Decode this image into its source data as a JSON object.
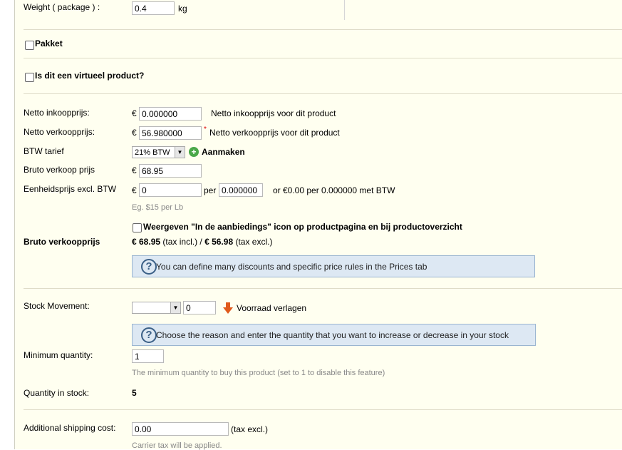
{
  "weight": {
    "label": "Weight ( package ) :",
    "value": "0.4",
    "unit": "kg"
  },
  "pakket": {
    "label": "Pakket"
  },
  "virtual": {
    "label": "Is dit een virtueel product?"
  },
  "netto_inkoop": {
    "label": "Netto inkoopprijs:",
    "currency": "€",
    "value": "0.000000",
    "note": "Netto inkoopprijs voor dit product"
  },
  "netto_verkoop": {
    "label": "Netto verkoopprijs:",
    "currency": "€",
    "value": "56.980000",
    "required": "*",
    "note": "Netto verkoopprijs voor dit product"
  },
  "btw": {
    "label": "BTW tarief",
    "selected": "21% BTW",
    "create_label": "Aanmaken"
  },
  "bruto_verkoop": {
    "label": "Bruto verkoop prijs",
    "currency": "€",
    "value": "68.95"
  },
  "unit_price": {
    "label": "Eenheidsprijs excl. BTW",
    "currency": "€",
    "value": "0",
    "per_label": "per",
    "per_value": "0.000000",
    "summary": "or €0.00 per 0.000000 met BTW",
    "hint": "Eg. $15 per Lb"
  },
  "on_sale": {
    "label": "Weergeven \"In de aanbiedings\" icon op productpagina en bij productoverzicht"
  },
  "bruto_summary": {
    "label": "Bruto verkoopprijs",
    "incl_value": "€ 68.95",
    "incl_text": "(tax incl.) /",
    "excl_value": "€ 56.98",
    "excl_text": "(tax excl.)"
  },
  "help_prices": "You can define many discounts and specific price rules in the Prices tab",
  "stock_movement": {
    "label": "Stock Movement:",
    "selected": "",
    "value": "0",
    "action": "Voorraad verlagen"
  },
  "help_stock": "Choose the reason and enter the quantity that you want to increase or decrease in your stock",
  "min_qty": {
    "label": "Minimum quantity:",
    "value": "1",
    "hint": "The minimum quantity to buy this product (set to 1 to disable this feature)"
  },
  "qty_stock": {
    "label": "Quantity in stock:",
    "value": "5"
  },
  "shipping": {
    "label": "Additional shipping cost:",
    "value": "0.00",
    "suffix": "(tax excl.)",
    "hint": "Carrier tax will be applied."
  },
  "colors": {
    "panel_bg": "#fffff0",
    "help_bg": "#dde8f3",
    "arrow_down": "#e05a1c",
    "add_icon": "#4aa84a"
  }
}
